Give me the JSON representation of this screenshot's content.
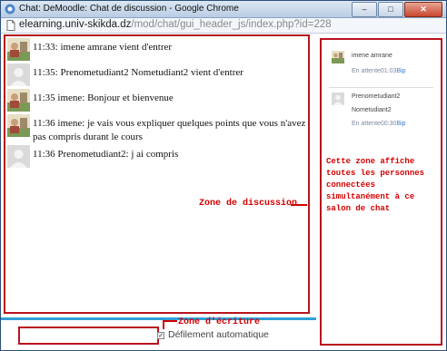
{
  "window": {
    "title": "Chat: DeMoodle: Chat de discussion - Google Chrome",
    "controls": {
      "minimize": "–",
      "maximize": "□",
      "close": "✕"
    }
  },
  "address": {
    "host": "elearning.univ-skikda.dz",
    "path": "/mod/chat/gui_header_js/index.php?id=228"
  },
  "messages": [
    {
      "avatar": "photo-avatar",
      "text": "11:33: imene amrane vient d'entrer"
    },
    {
      "avatar": "default-avatar",
      "text": "11:35: Prenometudiant2 Nometudiant2 vient d'entrer"
    },
    {
      "avatar": "photo-avatar",
      "text": "11:35 imene: Bonjour et bienvenue"
    },
    {
      "avatar": "photo-avatar",
      "text": "11:36 imene: je vais vous expliquer quelques points que vous n'avez pas compris durant le cours"
    },
    {
      "avatar": "default-avatar",
      "text": "11:36 Prenometudiant2: j ai compris"
    }
  ],
  "annotations": {
    "discussion": "Zone de discussion",
    "writing": "Zone d'écriture",
    "users": "Cette zone affiche toutes les personnes connectées simultanément à ce salon de chat"
  },
  "input": {
    "autoscroll_label": "Défilement automatique",
    "checkmark": "✓"
  },
  "users": [
    {
      "avatar": "photo-avatar",
      "name": "imene amrane",
      "status": "En attente01:03",
      "bip": "Bip"
    },
    {
      "avatar": "default-avatar",
      "name": "Prenometudiant2",
      "name2": "Nometudiant2",
      "status": "En attente00:30",
      "bip": "Bip"
    }
  ],
  "colors": {
    "annotation": "#d40000",
    "frame": "#b8141e",
    "separator": "#2f9fd8"
  }
}
